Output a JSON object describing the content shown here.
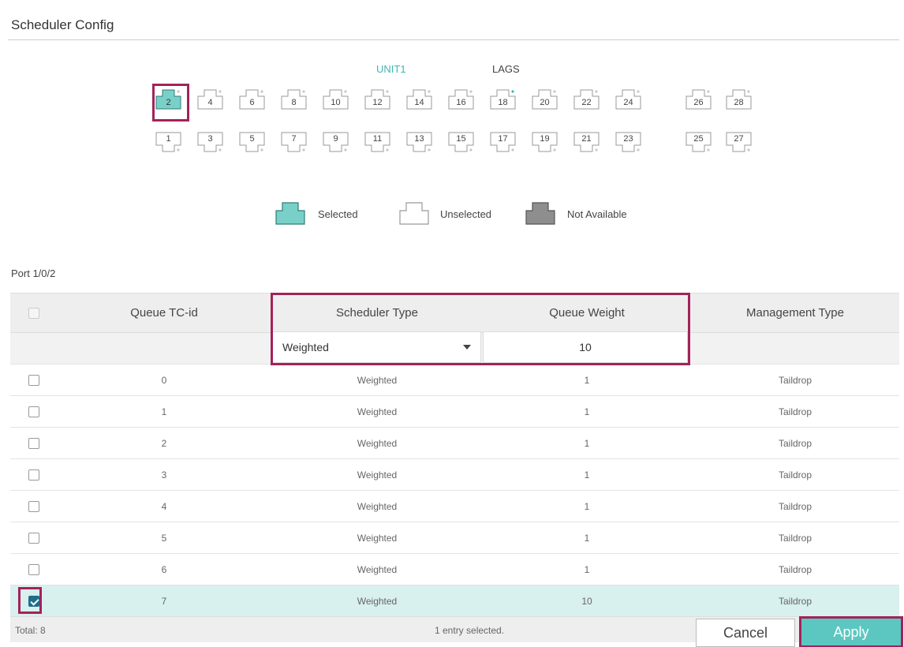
{
  "page": {
    "title": "Scheduler Config"
  },
  "units": {
    "unit1": "UNIT1",
    "lags": "LAGS"
  },
  "ports": {
    "top": [
      "2",
      "4",
      "6",
      "8",
      "10",
      "12",
      "14",
      "16",
      "18",
      "20",
      "22",
      "24",
      "26",
      "28"
    ],
    "bottom": [
      "1",
      "3",
      "5",
      "7",
      "9",
      "11",
      "13",
      "15",
      "17",
      "19",
      "21",
      "23",
      "25",
      "27"
    ],
    "selected": "2"
  },
  "legend": {
    "selected": "Selected",
    "unselected": "Unselected",
    "not_available": "Not Available"
  },
  "colors": {
    "selected": "#79d0c9",
    "accent": "#3fb6b0",
    "highlight": "#a3225a",
    "apply": "#5cc7c0"
  },
  "port_title": "Port 1/0/2",
  "table": {
    "headers": {
      "queue": "Queue TC-id",
      "scheduler": "Scheduler Type",
      "weight": "Queue Weight",
      "management": "Management Type"
    },
    "edit": {
      "scheduler_value": "Weighted",
      "weight_value": "10"
    },
    "rows": [
      {
        "id": "0",
        "scheduler": "Weighted",
        "weight": "1",
        "management": "Taildrop"
      },
      {
        "id": "1",
        "scheduler": "Weighted",
        "weight": "1",
        "management": "Taildrop"
      },
      {
        "id": "2",
        "scheduler": "Weighted",
        "weight": "1",
        "management": "Taildrop"
      },
      {
        "id": "3",
        "scheduler": "Weighted",
        "weight": "1",
        "management": "Taildrop"
      },
      {
        "id": "4",
        "scheduler": "Weighted",
        "weight": "1",
        "management": "Taildrop"
      },
      {
        "id": "5",
        "scheduler": "Weighted",
        "weight": "1",
        "management": "Taildrop"
      },
      {
        "id": "6",
        "scheduler": "Weighted",
        "weight": "1",
        "management": "Taildrop"
      },
      {
        "id": "7",
        "scheduler": "Weighted",
        "weight": "10",
        "management": "Taildrop"
      }
    ]
  },
  "footer": {
    "total": "Total: 8",
    "selected": "1 entry selected.",
    "cancel": "Cancel",
    "apply": "Apply"
  }
}
